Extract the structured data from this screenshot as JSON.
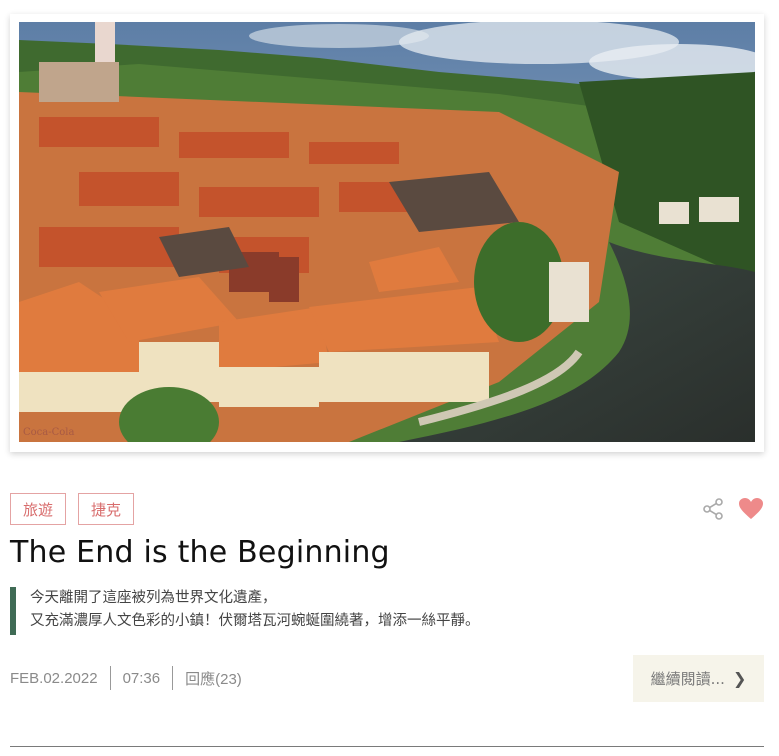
{
  "post": {
    "tags": [
      "旅遊",
      "捷克"
    ],
    "title": "The End is the Beginning",
    "excerpt_lines": [
      "今天離開了這座被列為世界文化遺產，",
      "又充滿濃厚人文色彩的小鎮！伏爾塔瓦河蜿蜒圍繞著，增添一絲平靜。"
    ],
    "date": "FEB.02.2022",
    "time": "07:36",
    "replies": "回應(23)",
    "read_more": "繼續閱讀...",
    "read_more_icon": "chevron-right-icon"
  },
  "icons": {
    "share": "share-icon",
    "like": "heart-icon"
  },
  "colors": {
    "tag_border": "#e4a3a3",
    "tag_text": "#d86d6d",
    "heart": "#ee8a8a",
    "excerpt_bar": "#3f6b55",
    "read_more_bg": "#f6f4ea"
  },
  "image": {
    "subject": "photo",
    "signage": "Coca-Cola"
  }
}
